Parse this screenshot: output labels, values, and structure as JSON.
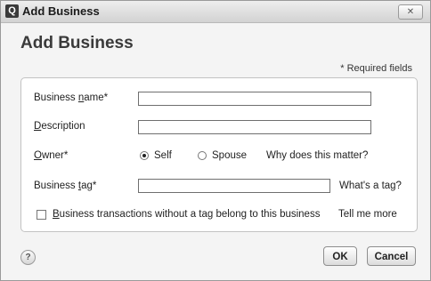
{
  "window": {
    "title": "Add Business",
    "app_icon": "Q",
    "close_label": "✕"
  },
  "dialog": {
    "heading": "Add Business",
    "required_note": "* Required fields"
  },
  "form": {
    "business_name": {
      "label_pre": "Business ",
      "label_u": "n",
      "label_post": "ame*",
      "value": ""
    },
    "description": {
      "label_pre": "",
      "label_u": "D",
      "label_post": "escription",
      "value": ""
    },
    "owner": {
      "label_pre": "",
      "label_u": "O",
      "label_post": "wner*",
      "options": [
        "Self",
        "Spouse"
      ],
      "selected": "Self",
      "help_link": "Why does this matter?"
    },
    "business_tag": {
      "label_pre": "Business ",
      "label_u": "t",
      "label_post": "ag*",
      "value": "",
      "help_link": "What's a tag?"
    },
    "no_tag_checkbox": {
      "label_u": "B",
      "label_post": "usiness transactions without a tag belong to this business",
      "checked": false,
      "help_link": "Tell me more"
    }
  },
  "footer": {
    "help_icon": "?",
    "ok_label": "OK",
    "cancel_label": "Cancel"
  }
}
